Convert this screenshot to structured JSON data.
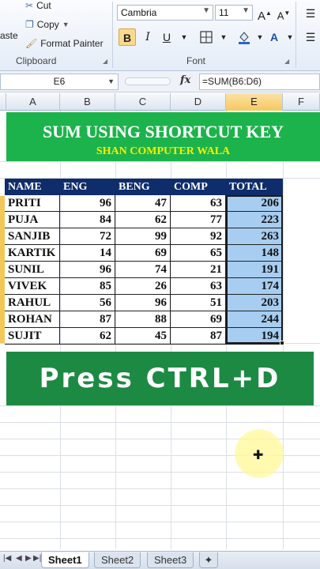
{
  "ribbon": {
    "clipboard": {
      "paste_label": "aste",
      "cut_label": "Cut",
      "copy_label": "Copy",
      "format_painter_label": "Format Painter",
      "group_label": "Clipboard"
    },
    "font": {
      "font_name": "Cambria",
      "font_size": "11",
      "grow_label": "A",
      "shrink_label": "A",
      "bold_label": "B",
      "italic_label": "I",
      "underline_label": "U",
      "font_color_label": "A",
      "group_label": "Font"
    }
  },
  "formula_bar": {
    "name_box": "E6",
    "fx_label": "fx",
    "formula": "=SUM(B6:D6)"
  },
  "columns": [
    "A",
    "B",
    "C",
    "D",
    "E",
    "F"
  ],
  "selected_column": "E",
  "banner": {
    "title": "SUM USING SHORTCUT KEY",
    "subtitle": "SHAN COMPUTER WALA"
  },
  "table": {
    "headers": [
      "NAME",
      "ENG",
      "BENG",
      "COMP",
      "TOTAL"
    ],
    "rows": [
      [
        "PRITI",
        "96",
        "47",
        "63",
        "206"
      ],
      [
        "PUJA",
        "84",
        "62",
        "77",
        "223"
      ],
      [
        "SANJIB",
        "72",
        "99",
        "92",
        "263"
      ],
      [
        "KARTIK",
        "14",
        "69",
        "65",
        "148"
      ],
      [
        "SUNIL",
        "96",
        "74",
        "21",
        "191"
      ],
      [
        "VIVEK",
        "85",
        "26",
        "63",
        "174"
      ],
      [
        "RAHUL",
        "56",
        "96",
        "51",
        "203"
      ],
      [
        "ROHAN",
        "87",
        "88",
        "69",
        "244"
      ],
      [
        "SUJIT",
        "62",
        "45",
        "87",
        "194"
      ]
    ]
  },
  "press_banner": "Press CTRL+D",
  "sheets": [
    "Sheet1",
    "Sheet2",
    "Sheet3"
  ],
  "active_sheet": "Sheet1",
  "colors": {
    "banner_green": "#1db34c",
    "banner_subtitle_yellow": "#f5f000",
    "table_header_navy": "#0f2c6b",
    "total_fill_blue": "#a7cdf1",
    "press_green": "#1d8a44"
  }
}
